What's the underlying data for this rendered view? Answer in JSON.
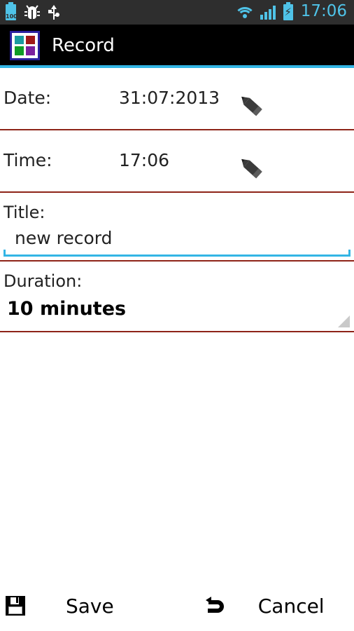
{
  "statusbar": {
    "battery_level_text": "100",
    "clock": "17:06",
    "icons": {
      "battery_100": "battery-100-icon",
      "debug": "android-debug-bug-icon",
      "usb": "usb-icon",
      "wifi": "wifi-icon",
      "signal": "cellular-signal-icon",
      "battery_charging": "battery-charging-icon"
    },
    "accent_color": "#4fc3e8",
    "background_color": "#2e2e2e"
  },
  "actionbar": {
    "title": "Record",
    "background_color": "#000000",
    "accent_line_color": "#33b5e5",
    "app_icon": {
      "name": "app-grid-icon",
      "border_color": "#2a1f9e",
      "tiles": [
        "#1a9ba1",
        "#a01818",
        "#0f9b27",
        "#7a1f9e"
      ]
    }
  },
  "form": {
    "divider_color": "#8e2418",
    "rows": [
      {
        "label": "Date:",
        "value": "31:07:2013",
        "edit_icon": "pencil-icon"
      },
      {
        "label": "Time:",
        "value": "17:06",
        "edit_icon": "pencil-icon"
      }
    ],
    "title_field": {
      "label": "Title:",
      "value": "new record",
      "placeholder": "new record",
      "underline_color": "#33b5e5"
    },
    "duration_field": {
      "label": "Duration:",
      "value": "10 minutes",
      "dropdown_icon": "spinner-caret-icon"
    }
  },
  "buttonbar": {
    "save": {
      "label": "Save",
      "icon": "floppy-disk-icon"
    },
    "cancel": {
      "label": "Cancel",
      "icon": "undo-arrow-icon"
    }
  }
}
